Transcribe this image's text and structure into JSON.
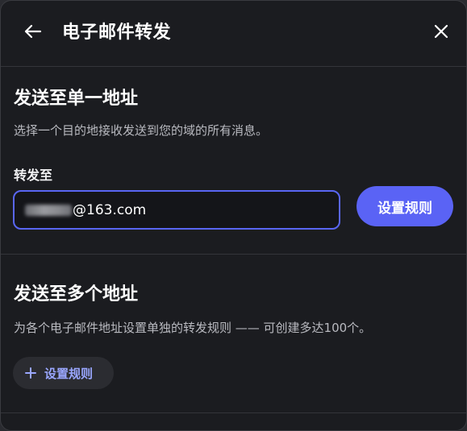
{
  "header": {
    "title": "电子邮件转发",
    "back_icon": "arrow-left-icon",
    "close_icon": "close-icon"
  },
  "single": {
    "title": "发送至单一地址",
    "description": "选择一个目的地接收发送到您的域的所有消息。",
    "field_label": "转发至",
    "email_value": "@163.com",
    "button_label": "设置规则"
  },
  "multiple": {
    "title": "发送至多个地址",
    "description": "为各个电子邮件地址设置单独的转发规则 —— 可创建多达100个。",
    "button_label": "设置规则",
    "button_icon": "plus-icon"
  },
  "colors": {
    "accent": "#5a63f5",
    "secondary_text": "#9aa7ff",
    "background": "#1b1c20"
  }
}
